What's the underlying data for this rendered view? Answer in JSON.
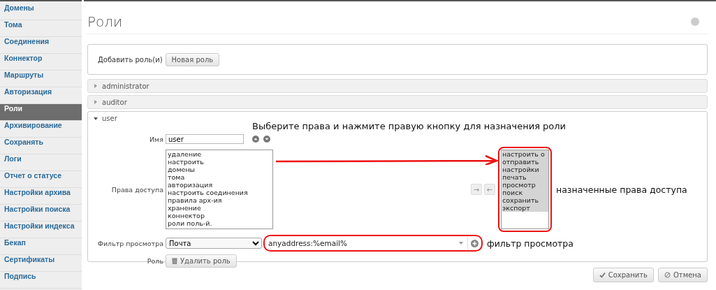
{
  "sidebar": {
    "items": [
      {
        "label": "Домены",
        "selected": false
      },
      {
        "label": "Тома",
        "selected": false
      },
      {
        "label": "Соединения",
        "selected": false
      },
      {
        "label": "Коннектор",
        "selected": false
      },
      {
        "label": "Маршруты",
        "selected": false
      },
      {
        "label": "Авторизация",
        "selected": false
      },
      {
        "label": "Роли",
        "selected": true
      },
      {
        "label": "Архивирование",
        "selected": false
      },
      {
        "label": "Сохранять",
        "selected": false
      },
      {
        "label": "Логи",
        "selected": false
      },
      {
        "label": "Отчет о статусе",
        "selected": false
      },
      {
        "label": "Настройки архива",
        "selected": false
      },
      {
        "label": "Настройки поиска",
        "selected": false
      },
      {
        "label": "Настройки индекса",
        "selected": false
      },
      {
        "label": "Бекап",
        "selected": false
      },
      {
        "label": "Сертификаты",
        "selected": false
      },
      {
        "label": "Подпись",
        "selected": false
      }
    ]
  },
  "page": {
    "title": "Роли"
  },
  "add_role": {
    "label": "Добавить роль(и)",
    "button": "Новая роль"
  },
  "roles": [
    {
      "name": "administrator",
      "expanded": false
    },
    {
      "name": "auditor",
      "expanded": false
    },
    {
      "name": "user",
      "expanded": true
    }
  ],
  "role_form": {
    "name_label": "Имя",
    "name_value": "user",
    "permissions_label": "Права доступа",
    "available_permissions": [
      {
        "label": "удаление",
        "selected": false
      },
      {
        "label": "настроить",
        "selected": false
      },
      {
        "label": "домены",
        "selected": false
      },
      {
        "label": "тома",
        "selected": false
      },
      {
        "label": "авторизация",
        "selected": false
      },
      {
        "label": "настроить соединения",
        "selected": false
      },
      {
        "label": "правила арх-ия",
        "selected": false
      },
      {
        "label": "хранение",
        "selected": false
      },
      {
        "label": "коннектор",
        "selected": false
      },
      {
        "label": "роли поль-й.",
        "selected": false
      }
    ],
    "move_right": "→",
    "move_left": "←",
    "assigned_permissions": [
      {
        "label": "настроить о",
        "selected": true
      },
      {
        "label": "отправить",
        "selected": true
      },
      {
        "label": "настройки",
        "selected": true
      },
      {
        "label": "печать",
        "selected": true
      },
      {
        "label": "просмотр",
        "selected": true
      },
      {
        "label": "поиск",
        "selected": true
      },
      {
        "label": "сохранить",
        "selected": true
      },
      {
        "label": "экспорт",
        "selected": true
      }
    ],
    "filter_label": "Фильтр просмотра",
    "filter_type": "Почта",
    "filter_value": "anyaddress:%email%",
    "role_label": "Роль",
    "delete_button": "Удалить роль"
  },
  "annotations": {
    "instruction": "Выберите права и нажмите правую кнопку для назначения роли",
    "assigned": "назначенные права доступа",
    "filter": "фильтр просмотра"
  },
  "footer": {
    "save": "Сохранить",
    "cancel": "Отмена"
  }
}
